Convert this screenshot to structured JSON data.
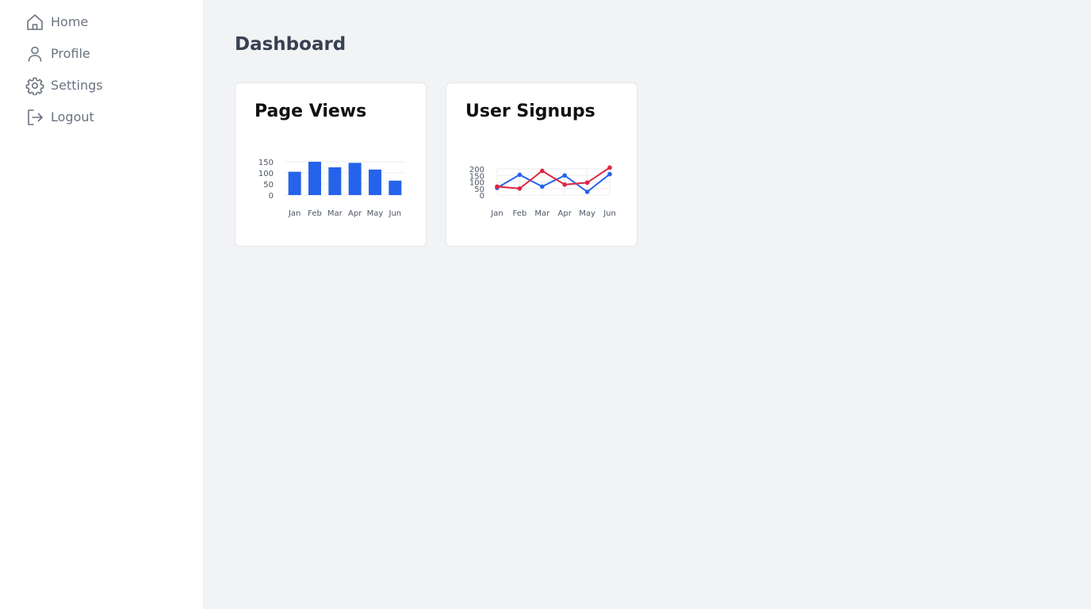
{
  "sidebar": {
    "items": [
      {
        "label": "Home",
        "icon": "home-icon"
      },
      {
        "label": "Profile",
        "icon": "user-icon"
      },
      {
        "label": "Settings",
        "icon": "gear-icon"
      },
      {
        "label": "Logout",
        "icon": "logout-icon"
      }
    ]
  },
  "main": {
    "title": "Dashboard"
  },
  "cards": [
    {
      "title": "Page Views"
    },
    {
      "title": "User Signups"
    }
  ],
  "colors": {
    "primary": "#2563eb",
    "secondary": "#dc2643",
    "sidebar_text": "#6b7280",
    "page_background": "#f2f3f5"
  },
  "chart_data": [
    {
      "type": "bar",
      "title": "Page Views",
      "categories": [
        "Jan",
        "Feb",
        "Mar",
        "Apr",
        "May",
        "Jun"
      ],
      "values": [
        105,
        150,
        125,
        145,
        115,
        65
      ],
      "yticks": [
        0,
        50,
        100,
        150
      ],
      "ylim": [
        0,
        150
      ],
      "grid": true,
      "color": "#2563eb"
    },
    {
      "type": "line",
      "title": "User Signups",
      "categories": [
        "Jan",
        "Feb",
        "Mar",
        "Apr",
        "May",
        "Jun"
      ],
      "yticks": [
        0,
        50,
        100,
        150,
        200
      ],
      "ylim": [
        0,
        200
      ],
      "grid": true,
      "series": [
        {
          "color": "#2563eb",
          "values": [
            55,
            155,
            65,
            150,
            25,
            160
          ]
        },
        {
          "color": "#dc2643",
          "values": [
            65,
            50,
            185,
            80,
            95,
            210
          ]
        }
      ]
    }
  ]
}
